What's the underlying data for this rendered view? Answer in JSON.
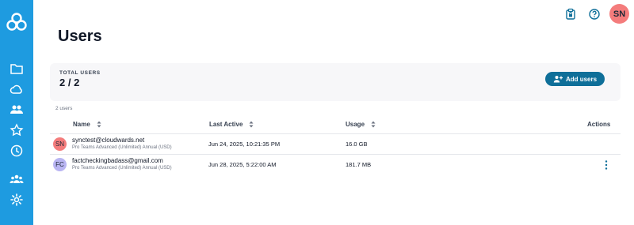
{
  "sidebar": {
    "logo": "sync-logo-icon",
    "items": [
      {
        "icon": "folder-icon"
      },
      {
        "icon": "cloud-icon"
      },
      {
        "icon": "shared-users-icon"
      },
      {
        "icon": "star-icon"
      },
      {
        "icon": "clock-icon"
      },
      {
        "icon": "team-icon"
      },
      {
        "icon": "gear-icon"
      }
    ]
  },
  "topbar": {
    "icons": [
      "lock-clipboard-icon",
      "help-icon"
    ],
    "avatar_initials": "SN"
  },
  "page": {
    "title": "Users"
  },
  "summary": {
    "total_label": "TOTAL USERS",
    "total_value": "2 / 2",
    "add_button_label": "Add users"
  },
  "table": {
    "count_label": "2 users",
    "headers": {
      "name": "Name",
      "last_active": "Last Active",
      "usage": "Usage",
      "actions": "Actions"
    },
    "rows": [
      {
        "initials": "SN",
        "avatar_color": "#f47c7c",
        "email": "synctest@cloudwards.net",
        "plan": "Pro Teams Advanced (Unlimited) Annual (USD)",
        "last_active": "Jun 24, 2025, 10:21:35 PM",
        "usage": "16.0 GB",
        "has_actions": false
      },
      {
        "initials": "FC",
        "avatar_color": "#b9b5f2",
        "email": "factcheckingbadass@gmail.com",
        "plan": "Pro Teams Advanced (Unlimited) Annual (USD)",
        "last_active": "Jun 28, 2025, 5:22:00 AM",
        "usage": "181.7 MB",
        "has_actions": true
      }
    ]
  },
  "colors": {
    "sidebar": "#1e9be0",
    "primary_button": "#0f6f99",
    "accent": "#0f6f99"
  }
}
